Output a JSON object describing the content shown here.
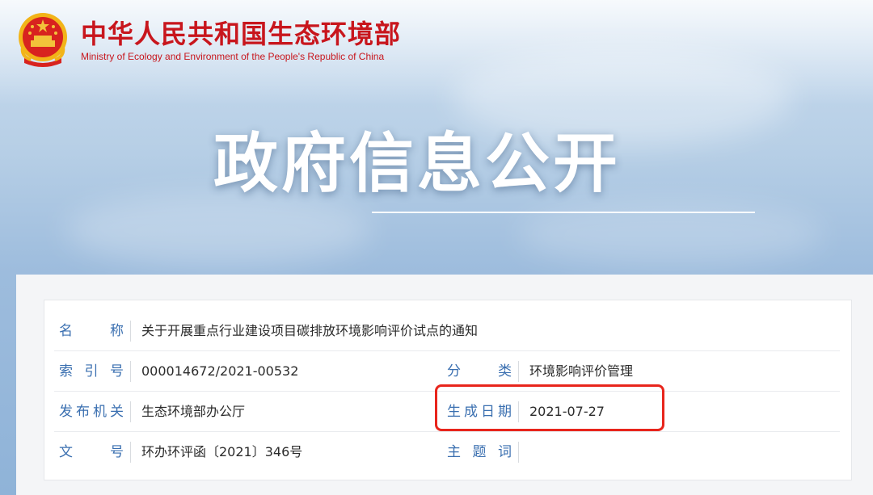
{
  "header": {
    "title_cn": "中华人民共和国生态环境部",
    "title_en": "Ministry of Ecology and Environment of the People's Republic of China",
    "emblem_icon": "national-emblem-icon"
  },
  "hero": {
    "title": "政府信息公开"
  },
  "info": {
    "name_label": "名　　称",
    "name_value": "关于开展重点行业建设项目碳排放环境影响评价试点的通知",
    "index_label": "索 引 号",
    "index_value": "000014672/2021-00532",
    "category_label": "分　　类",
    "category_value": "环境影响评价管理",
    "publisher_label": "发布机关",
    "publisher_value": "生态环境部办公厅",
    "date_label": "生成日期",
    "date_value": "2021-07-27",
    "doc_no_label": "文　　号",
    "doc_no_value": "环办环评函〔2021〕346号",
    "keywords_label": "主 题 词",
    "keywords_value": ""
  },
  "colors": {
    "brand_red": "#c8161d",
    "label_blue": "#3a6fb0",
    "highlight_red": "#e8251c"
  }
}
